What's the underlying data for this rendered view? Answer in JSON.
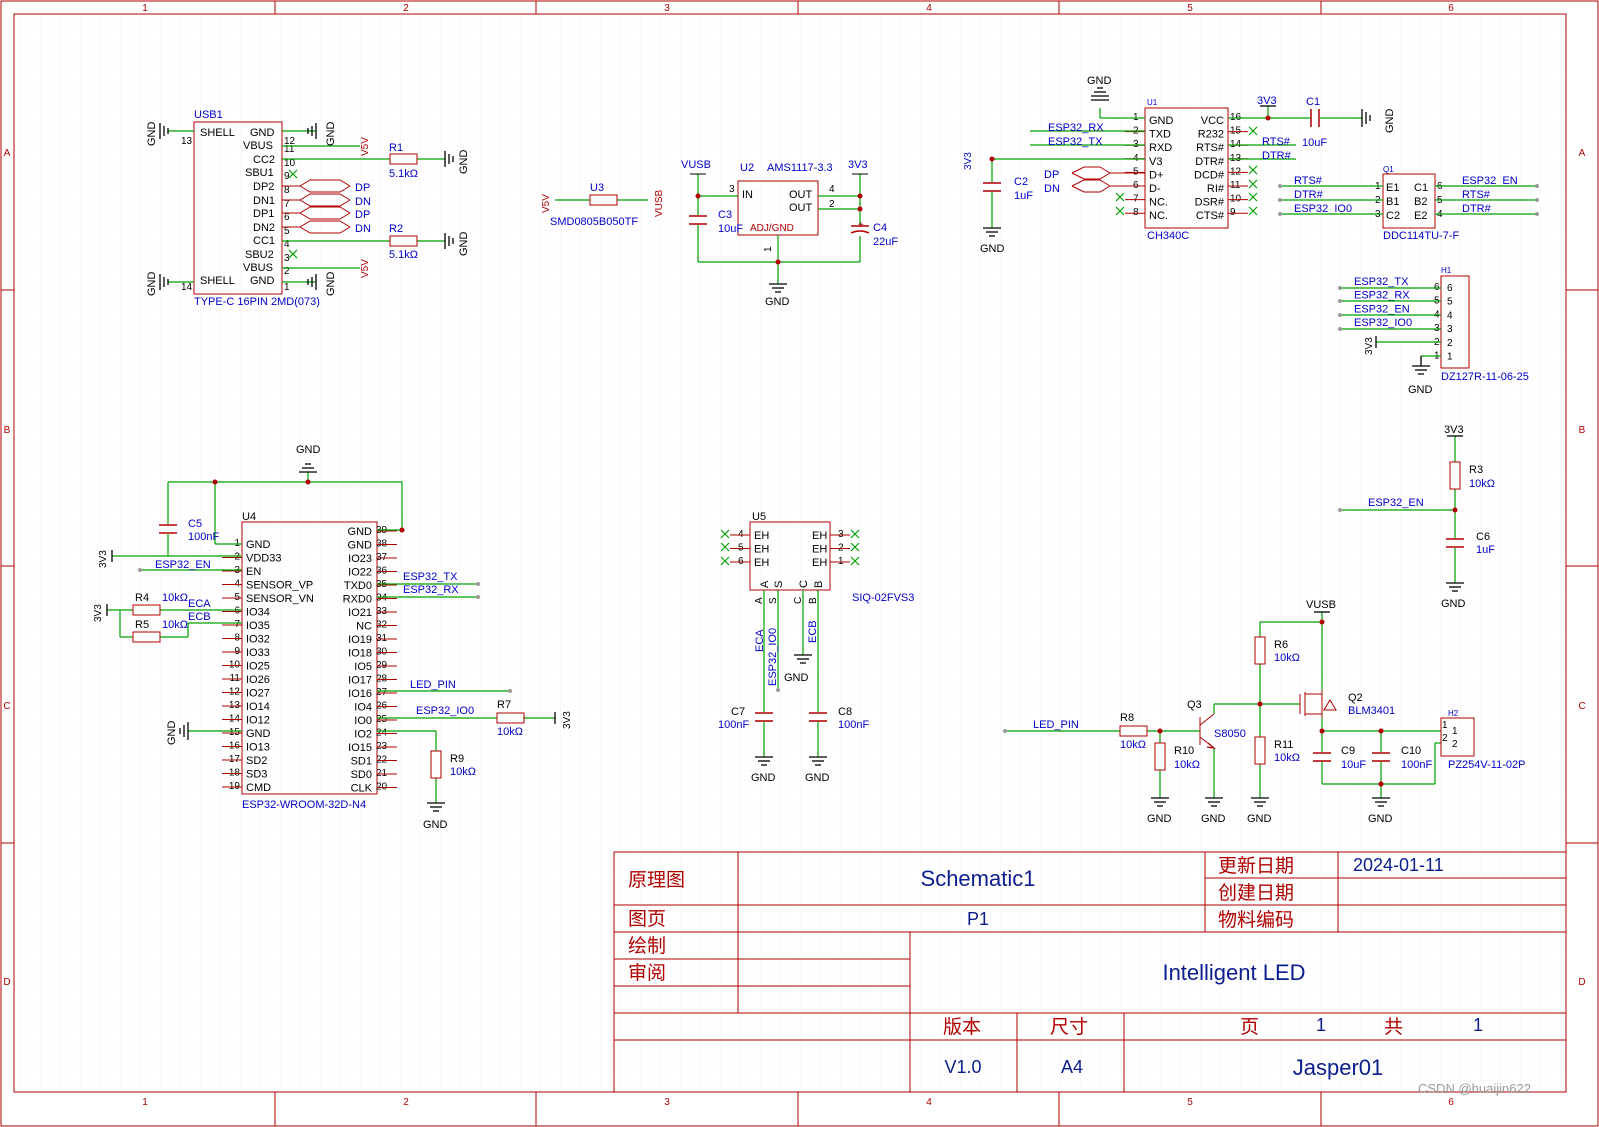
{
  "colors": {
    "wire": "#00a000",
    "part": "#b00000",
    "label": "#0000c8",
    "pin": "#000000",
    "grid": "#dcdcdc",
    "net": "#b00000"
  },
  "border": {
    "cols": [
      "1",
      "2",
      "3",
      "4",
      "5",
      "6"
    ],
    "rows": [
      "A",
      "B",
      "C",
      "D"
    ]
  },
  "gnd": "GND",
  "usb": {
    "ref": "USB1",
    "model": "TYPE-C 16PIN 2MD(073)",
    "left_pins": [
      "SHELL",
      "GND",
      "VBUS",
      "CC2",
      "SBU1",
      "DP2",
      "DN1",
      "DP1",
      "DN2",
      "CC1",
      "SBU2",
      "VBUS",
      "SHELL",
      "GND"
    ],
    "nums": [
      "13",
      "12",
      "11",
      "10",
      "9",
      "8",
      "7",
      "6",
      "5",
      "4",
      "3",
      "2",
      "14",
      "1"
    ],
    "dp": "DP",
    "dn": "DN",
    "v5v": "V5V",
    "r1": "R1",
    "r1v": "5.1kΩ",
    "r2": "R2",
    "r2v": "5.1kΩ"
  },
  "u3": {
    "ref": "U3",
    "model": "SMD0805B050TF",
    "left": "V5V",
    "right": "VUSB"
  },
  "u2": {
    "ref": "U2",
    "model": "AMS1117-3.3",
    "vin": "VUSB",
    "vout": "3V3",
    "in": "IN",
    "out": "OUT",
    "adj": "ADJ/GND",
    "p3": "3",
    "p4": "4",
    "p2": "2",
    "p1": "1",
    "c3": "C3",
    "c3v": "10uF",
    "c4": "C4",
    "c4v": "22uF"
  },
  "u1": {
    "ref": "U1",
    "model": "CH340C",
    "left": [
      "GND",
      "TXD",
      "RXD",
      "V3",
      "D+",
      "D-",
      "NC.",
      "NC."
    ],
    "lnum": [
      "1",
      "2",
      "3",
      "4",
      "5",
      "6",
      "7",
      "8"
    ],
    "right": [
      "VCC",
      "R232",
      "RTS#",
      "DTR#",
      "DCD#",
      "RI#",
      "DSR#",
      "CTS#"
    ],
    "rnum": [
      "16",
      "15",
      "14",
      "13",
      "12",
      "11",
      "10",
      "9"
    ],
    "tx": "ESP32_RX",
    "rx": "ESP32_TX",
    "v3": "3V3",
    "c2": "C2",
    "c2v": "1uF",
    "dp": "DP",
    "dn": "DN",
    "rts": "RTS#",
    "dtr": "DTR#",
    "c1": "C1",
    "c1v": "10uF",
    "vcc": "3V3"
  },
  "q1": {
    "ref": "Q1",
    "model": "DDC114TU-7-F",
    "left": [
      "E1",
      "B1",
      "C2"
    ],
    "right": [
      "C1",
      "B2",
      "E2"
    ],
    "lnum": [
      "1",
      "2",
      "3"
    ],
    "rnum": [
      "6",
      "5",
      "4"
    ],
    "in": [
      "RTS#",
      "DTR#",
      "ESP32_IO0"
    ],
    "out": [
      "ESP32_EN",
      "RTS#",
      "DTR#"
    ]
  },
  "h1": {
    "ref": "H1",
    "model": "DZ127R-11-06-25",
    "nets": [
      "ESP32_TX",
      "ESP32_RX",
      "ESP32_EN",
      "ESP32_IO0"
    ],
    "nums": [
      "6",
      "5",
      "4",
      "3",
      "2",
      "1"
    ],
    "v": "3V3"
  },
  "u4": {
    "ref": "U4",
    "model": "ESP32-WROOM-32D-N4",
    "left": [
      "GND",
      "VDD33",
      "EN",
      "SENSOR_VP",
      "SENSOR_VN",
      "IO34",
      "IO35",
      "IO32",
      "IO33",
      "IO25",
      "IO26",
      "IO27",
      "IO14",
      "IO12",
      "GND",
      "IO13",
      "SD2",
      "SD3",
      "CMD"
    ],
    "lnum": [
      "1",
      "2",
      "3",
      "4",
      "5",
      "6",
      "7",
      "8",
      "9",
      "10",
      "11",
      "12",
      "13",
      "14",
      "15",
      "16",
      "17",
      "18",
      "19"
    ],
    "right": [
      "GND",
      "GND",
      "IO23",
      "IO22",
      "TXD0",
      "RXD0",
      "IO21",
      "NC",
      "IO19",
      "IO18",
      "IO5",
      "IO17",
      "IO16",
      "IO4",
      "IO0",
      "IO2",
      "IO15",
      "SD1",
      "SD0",
      "CLK"
    ],
    "rnum": [
      "39",
      "38",
      "37",
      "36",
      "35",
      "34",
      "33",
      "32",
      "31",
      "30",
      "29",
      "28",
      "27",
      "26",
      "25",
      "24",
      "23",
      "22",
      "21",
      "20"
    ],
    "v3": "3V3",
    "en": "ESP32_EN",
    "c5": "C5",
    "c5v": "100nF",
    "r4": "R4",
    "r4v": "10kΩ",
    "r5": "R5",
    "r5v": "10kΩ",
    "eca": "ECA",
    "ecb": "ECB",
    "tx": "ESP32_TX",
    "rx": "ESP32_RX",
    "led": "LED_PIN",
    "io0": "ESP32_IO0",
    "r7": "R7",
    "r7v": "10kΩ",
    "r9": "R9",
    "r9v": "10kΩ"
  },
  "u5": {
    "ref": "U5",
    "model": "SIQ-02FVS3",
    "eh": "EH",
    "lnum": [
      "4",
      "5",
      "6"
    ],
    "rnum": [
      "3",
      "2",
      "1"
    ],
    "bottom": [
      "A",
      "S",
      "C",
      "B"
    ],
    "eca": "ECA",
    "io0": "ESP32_IO0",
    "ecb": "ECB",
    "c7": "C7",
    "c7v": "100nF",
    "c8": "C8",
    "c8v": "100nF"
  },
  "rc": {
    "v": "3V3",
    "r3": "R3",
    "r3v": "10kΩ",
    "en": "ESP32_EN",
    "c6": "C6",
    "c6v": "1uF"
  },
  "drv": {
    "vusb": "VUSB",
    "led": "LED_PIN",
    "r8": "R8",
    "r8v": "10kΩ",
    "r10": "R10",
    "r10v": "10kΩ",
    "q3": "Q3",
    "q3m": "S8050",
    "r6": "R6",
    "r6v": "10kΩ",
    "r11": "R11",
    "r11v": "10kΩ",
    "q2": "Q2",
    "q2m": "BLM3401",
    "c9": "C9",
    "c9v": "10uF",
    "c10": "C10",
    "c10v": "100nF",
    "h2": "H2",
    "h2m": "PZ254V-11-02P",
    "p1": "1",
    "p2": "2"
  },
  "title_block": {
    "schematic_label": "原理图",
    "schematic": "Schematic1",
    "sheet_label": "图页",
    "sheet": "P1",
    "drawn": "绘制",
    "review": "审阅",
    "update_label": "更新日期",
    "update": "2024-01-11",
    "create_label": "创建日期",
    "part_label": "物料编码",
    "project": "Intelligent LED",
    "version_label": "版本",
    "size_label": "尺寸",
    "page_label": "页",
    "page": "1",
    "total_label": "共",
    "total": "1",
    "version": "V1.0",
    "size": "A4",
    "author": "Jasper01"
  },
  "watermark": "CSDN @huaijin622"
}
